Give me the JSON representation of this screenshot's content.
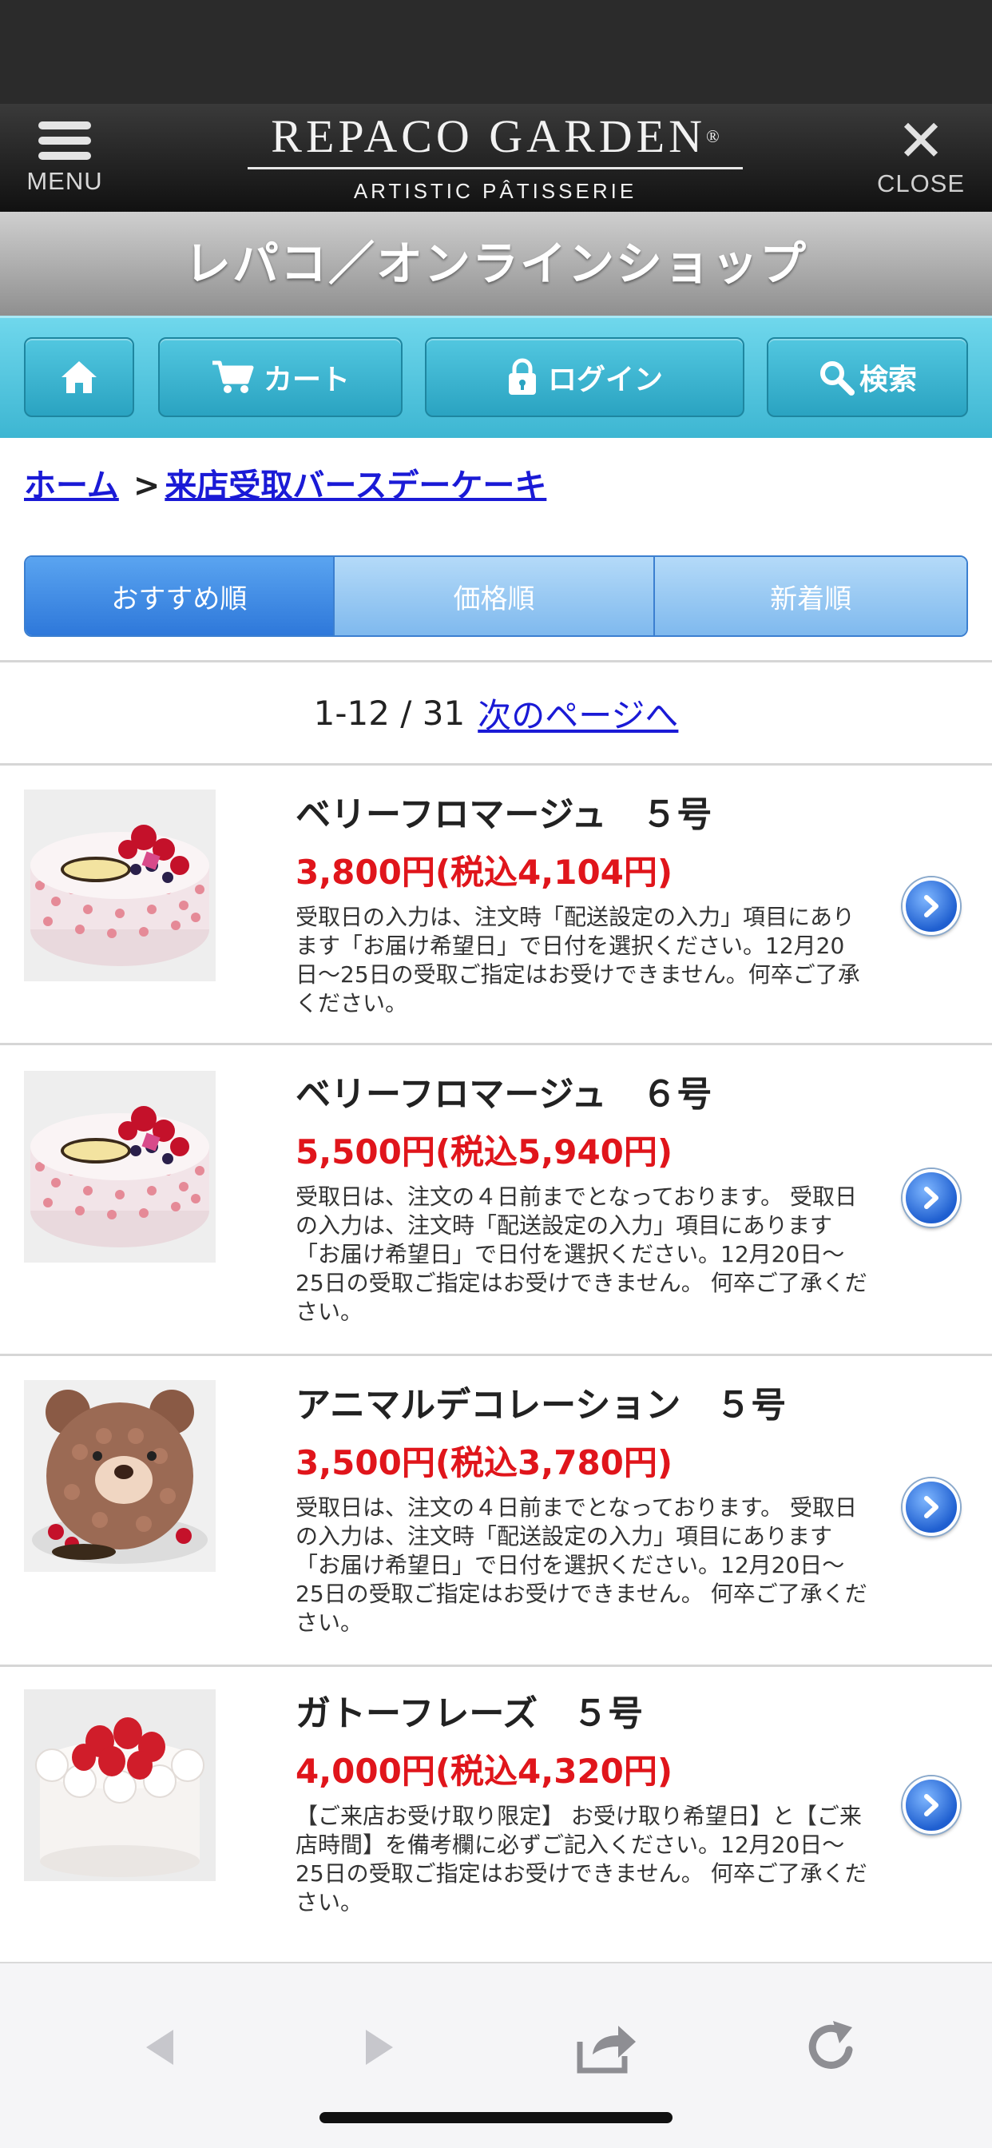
{
  "header": {
    "menu_label": "MENU",
    "brand_name": "REPACO GARDEN",
    "brand_registered": "®",
    "brand_sub": "ARTISTIC PÂTISSERIE",
    "close_label": "CLOSE"
  },
  "shop_title": "レパコ／オンラインショップ",
  "nav": {
    "home_icon": "home-icon",
    "cart_label": "カート",
    "login_label": "ログイン",
    "search_label": "検索"
  },
  "breadcrumb": {
    "home": "ホーム",
    "separator": ">",
    "category": "来店受取バースデーケーキ"
  },
  "sort": {
    "recommended": "おすすめ順",
    "price": "価格順",
    "newest": "新着順",
    "active": "recommended"
  },
  "pager": {
    "count": "1-12 / 31",
    "next": "次のページへ"
  },
  "products": [
    {
      "title": "ベリーフロマージュ　５号",
      "price": "3,800円(税込4,104円)",
      "desc": "受取日の入力は、注文時「配送設定の入力」項目にあります「お届け希望日」で日付を選択ください。12月20日〜25日の受取ご指定はお受けできません。何卒ご了承ください。",
      "image": "berry-cake"
    },
    {
      "title": "ベリーフロマージュ　６号",
      "price": "5,500円(税込5,940円)",
      "desc": "受取日は、注文の４日前までとなっております。 受取日の入力は、注文時「配送設定の入力」項目にあります「お届け希望日」で日付を選択ください。12月20日〜25日の受取ご指定はお受けできません。 何卒ご了承ください。",
      "image": "berry-cake"
    },
    {
      "title": "アニマルデコレーション　５号",
      "price": "3,500円(税込3,780円)",
      "desc": "受取日は、注文の４日前までとなっております。 受取日の入力は、注文時「配送設定の入力」項目にあります「お届け希望日」で日付を選択ください。12月20日〜25日の受取ご指定はお受けできません。 何卒ご了承ください。",
      "image": "bear-cake"
    },
    {
      "title": "ガトーフレーズ　５号",
      "price": "4,000円(税込4,320円)",
      "desc": "【ご来店お受け取り限定】 お受け取り希望日】と【ご来店時間】を備考欄に必ずご記入ください。12月20日〜25日の受取ご指定はお受けできません。 何卒ご了承ください。",
      "image": "strawberry-cake"
    }
  ],
  "colors": {
    "price_red": "#e0151b",
    "link_blue": "#1a1ad6",
    "nav_cyan": "#3db6d2",
    "sort_active": "#2e78da"
  }
}
